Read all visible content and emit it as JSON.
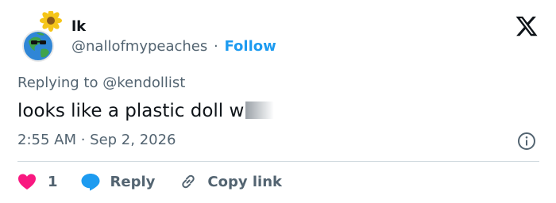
{
  "author": {
    "display_name": "lk",
    "handle": "@nallofmypeaches",
    "separator": "·",
    "follow_label": "Follow",
    "avatar_icon": "earth-sunflower-avatar-icon"
  },
  "platform_logo": "x-logo-icon",
  "reply": {
    "prefix": "Replying to",
    "target": "@kendollist"
  },
  "tweet": {
    "text": "looks like a plastic doll w"
  },
  "meta": {
    "timestamp": "2:55 AM · Sep 2, 2026"
  },
  "actions": {
    "like_count": "1",
    "reply_label": "Reply",
    "copy_label": "Copy link"
  },
  "colors": {
    "accent": "#1d9bf0",
    "like": "#f91880",
    "secondary_text": "#536471",
    "primary_text": "#0f1419"
  }
}
